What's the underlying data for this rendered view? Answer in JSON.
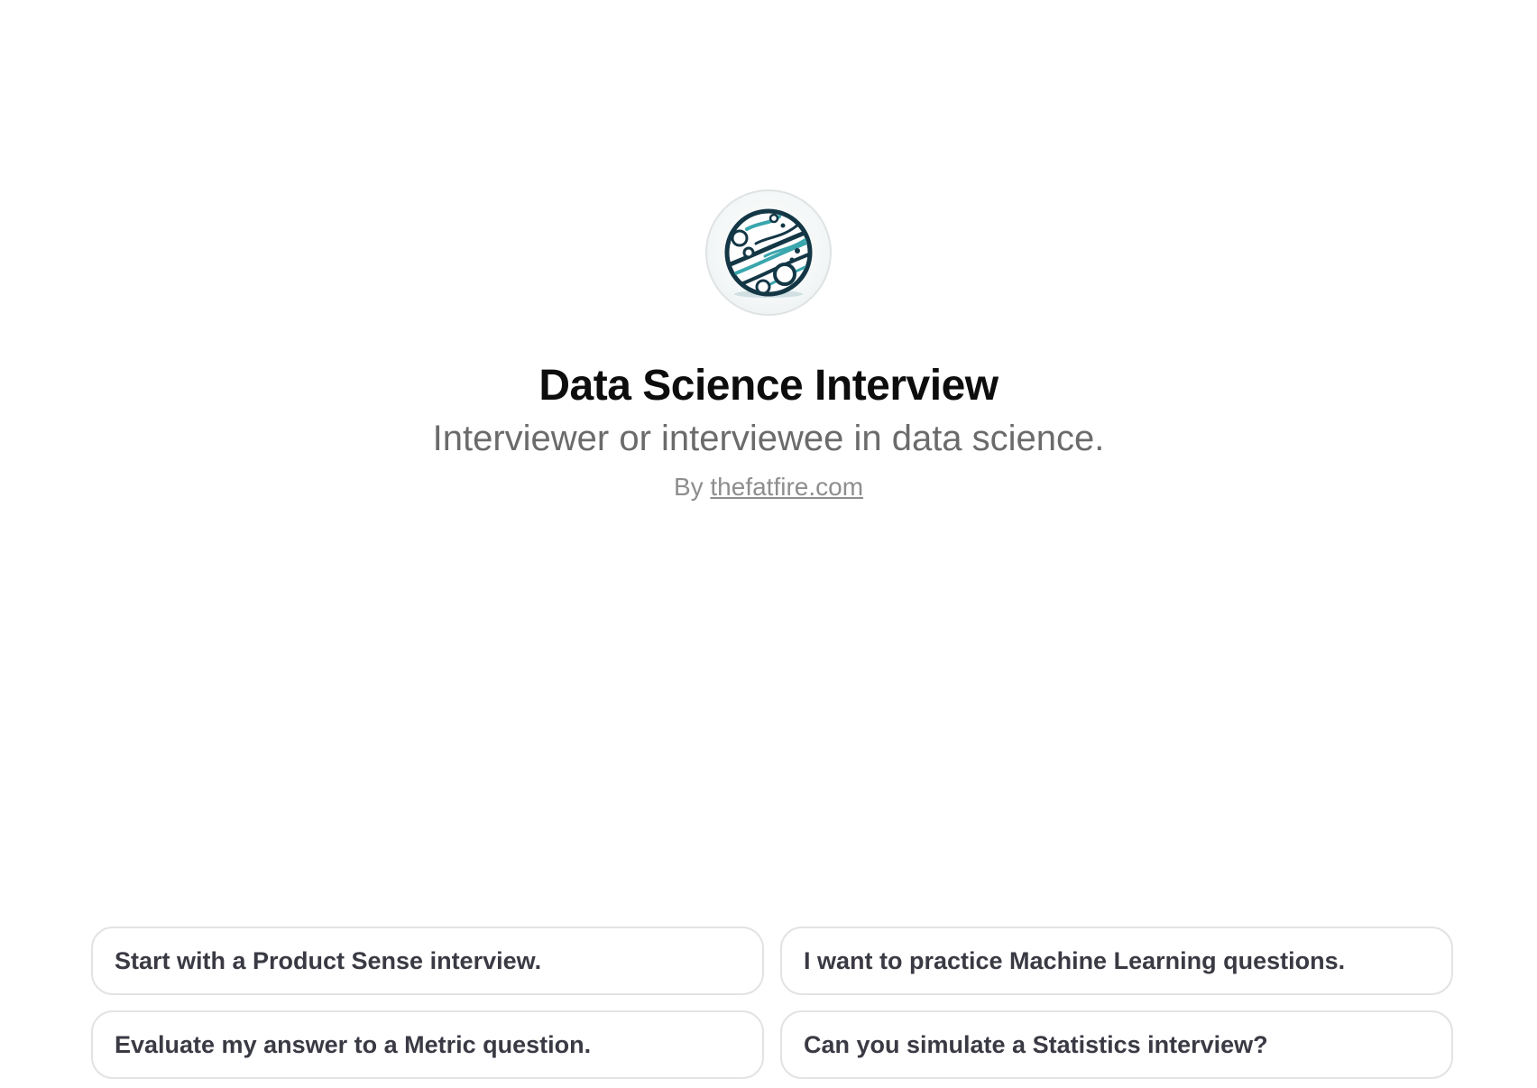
{
  "gpt": {
    "icon": "data-science-circuit-logo",
    "title": "Data Science Interview",
    "description": "Interviewer or interviewee in data science.",
    "by_prefix": "By",
    "author": "thefatfire.com"
  },
  "prompts": [
    "Start with a Product Sense interview.",
    "I want to practice Machine Learning questions.",
    "Evaluate my answer to a Metric question.",
    "Can you simulate a Statistics interview?"
  ],
  "colors": {
    "title": "#0d0d0d",
    "subtitle": "#6b6b6b",
    "muted": "#8e8e8e",
    "prompt_text": "#3a3a44",
    "border": "#e3e3e3",
    "logo_dark": "#143746",
    "logo_teal": "#3aa6ad"
  }
}
